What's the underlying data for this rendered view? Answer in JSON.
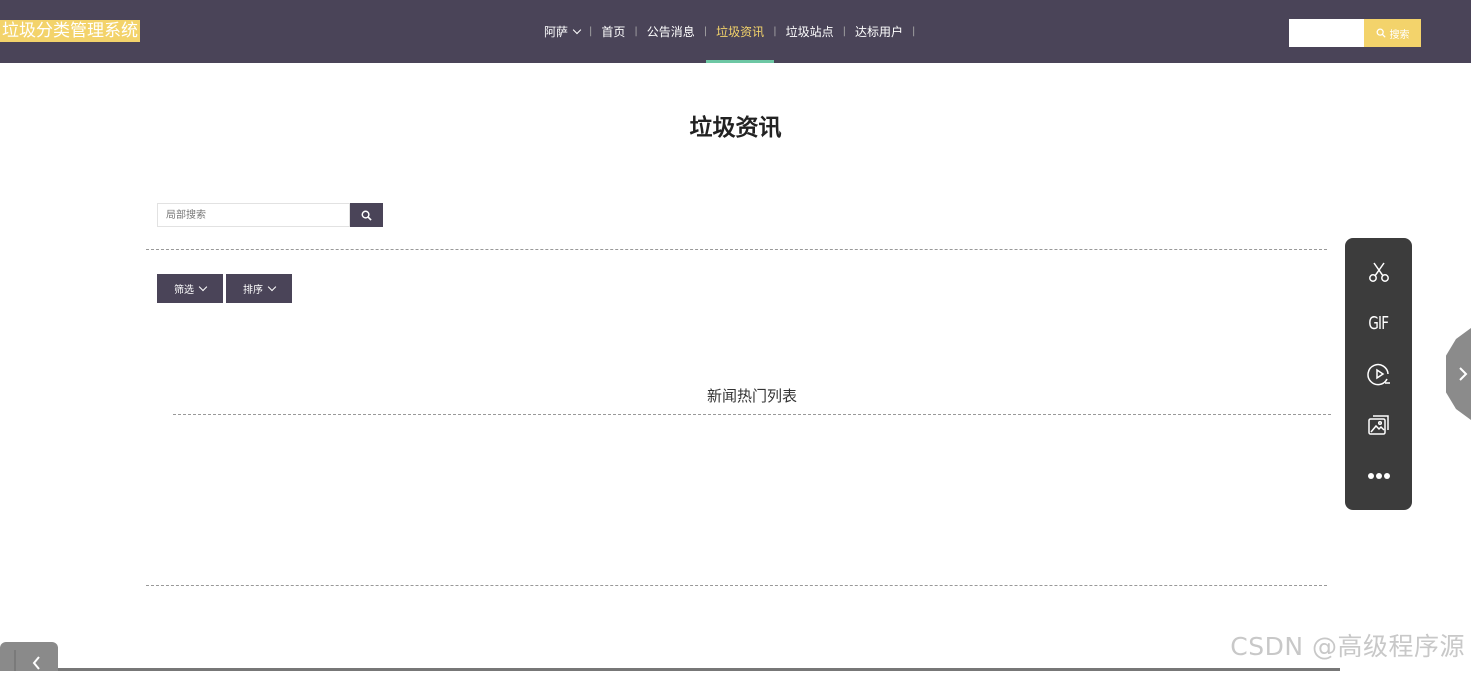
{
  "header": {
    "brand": "垃圾分类管理系统",
    "nav": [
      {
        "label": "阿萨",
        "dropdown": true
      },
      {
        "label": "首页"
      },
      {
        "label": "公告消息"
      },
      {
        "label": "垃圾资讯",
        "active": true
      },
      {
        "label": "垃圾站点"
      },
      {
        "label": "达标用户"
      }
    ],
    "search_button": "搜索"
  },
  "main": {
    "title": "垃圾资讯",
    "local_search_placeholder": "局部搜索",
    "filter_label": "筛选",
    "sort_label": "排序",
    "section_title": "新闻热门列表"
  },
  "side_toolbar": {
    "items": [
      "scissors-icon",
      "gif-icon",
      "record-icon",
      "screenshot-icon",
      "more-icon"
    ],
    "gif_label": "GIF"
  },
  "watermark": "CSDN @高级程序源",
  "colors": {
    "header_bg": "#4a4458",
    "accent": "#f3d36b",
    "active_underline": "#6dc7a4",
    "button_bg": "#4a4458"
  }
}
